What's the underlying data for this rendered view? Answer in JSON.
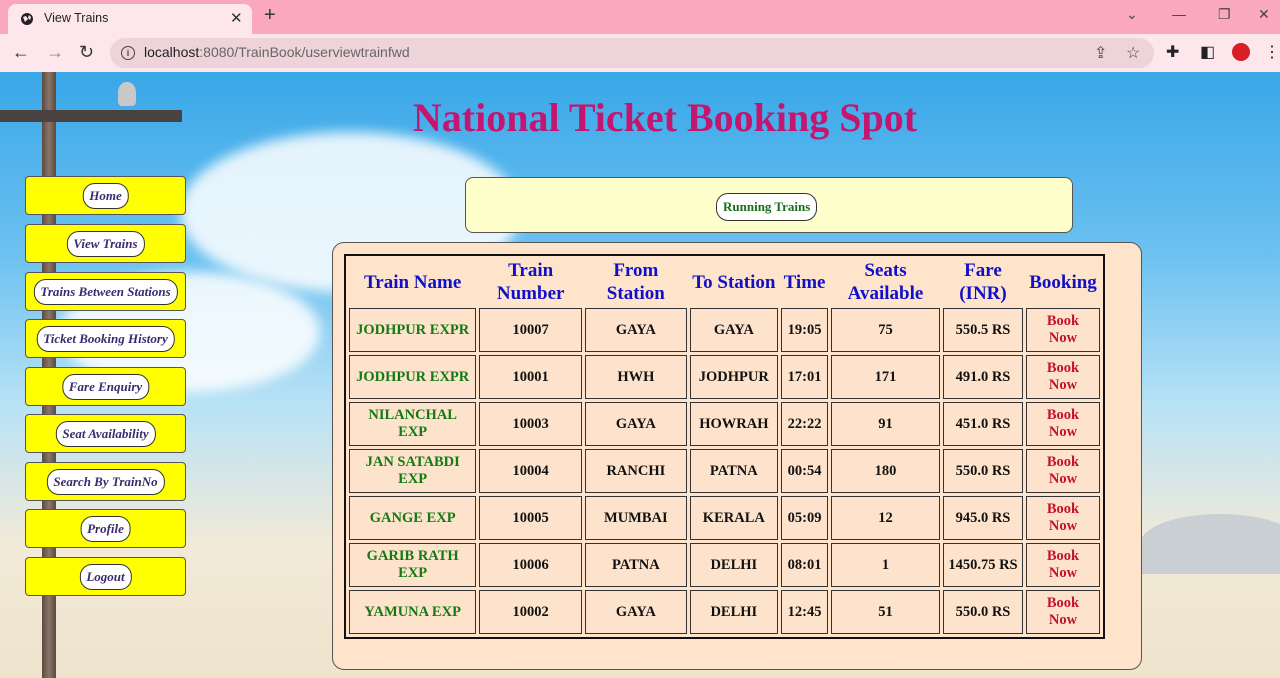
{
  "browser": {
    "tab_title": "View Trains",
    "url_host": "localhost",
    "url_path": ":8080/TrainBook/userviewtrainfwd"
  },
  "site": {
    "title": "National Ticket Booking Spot"
  },
  "sidebar": {
    "items": [
      {
        "label": "Home"
      },
      {
        "label": "View Trains"
      },
      {
        "label": "Trains Between Stations"
      },
      {
        "label": "Ticket Booking History"
      },
      {
        "label": "Fare Enquiry"
      },
      {
        "label": "Seat Availability"
      },
      {
        "label": "Search By TrainNo"
      },
      {
        "label": "Profile"
      },
      {
        "label": "Logout"
      }
    ]
  },
  "running": {
    "label": "Running Trains"
  },
  "table": {
    "headers": [
      "Train Name",
      "Train Number",
      "From Station",
      "To Station",
      "Time",
      "Seats Available",
      "Fare (INR)",
      "Booking"
    ],
    "rows": [
      {
        "name": "JODHPUR EXPR",
        "number": "10007",
        "from": "GAYA",
        "to": "GAYA",
        "time": "19:05",
        "seats": "75",
        "fare": "550.5 RS",
        "booking": "Book Now"
      },
      {
        "name": "JODHPUR EXPR",
        "number": "10001",
        "from": "HWH",
        "to": "JODHPUR",
        "time": "17:01",
        "seats": "171",
        "fare": "491.0 RS",
        "booking": "Book Now"
      },
      {
        "name": "NILANCHAL EXP",
        "number": "10003",
        "from": "GAYA",
        "to": "HOWRAH",
        "time": "22:22",
        "seats": "91",
        "fare": "451.0 RS",
        "booking": "Book Now"
      },
      {
        "name": "JAN SATABDI EXP",
        "number": "10004",
        "from": "RANCHI",
        "to": "PATNA",
        "time": "00:54",
        "seats": "180",
        "fare": "550.0 RS",
        "booking": "Book Now"
      },
      {
        "name": "GANGE EXP",
        "number": "10005",
        "from": "MUMBAI",
        "to": "KERALA",
        "time": "05:09",
        "seats": "12",
        "fare": "945.0 RS",
        "booking": "Book Now"
      },
      {
        "name": "GARIB RATH EXP",
        "number": "10006",
        "from": "PATNA",
        "to": "DELHI",
        "time": "08:01",
        "seats": "1",
        "fare": "1450.75 RS",
        "booking": "Book Now"
      },
      {
        "name": "YAMUNA EXP",
        "number": "10002",
        "from": "GAYA",
        "to": "DELHI",
        "time": "12:45",
        "seats": "51",
        "fare": "550.0 RS",
        "booking": "Book Now"
      }
    ]
  },
  "colors": {
    "title": "#c4156f",
    "header": "#1010c8",
    "train_name": "#137a13",
    "book": "#c4102a",
    "sidebar_bg": "#ffff00"
  },
  "icons": [
    "globe-icon",
    "close-icon",
    "plus-icon",
    "back-icon",
    "forward-icon",
    "reload-icon",
    "info-icon",
    "share-icon",
    "star-icon",
    "puzzle-icon",
    "sidepanel-icon",
    "profile-icon",
    "menu-icon"
  ]
}
